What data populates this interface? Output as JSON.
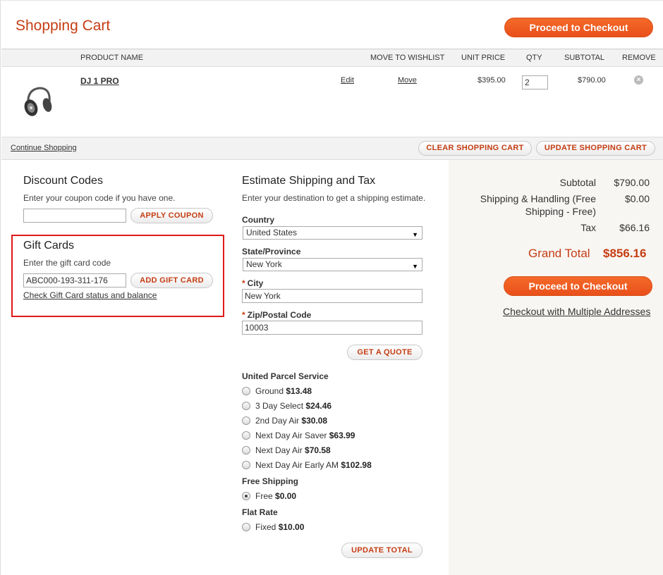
{
  "header": {
    "title": "Shopping Cart",
    "checkout_label": "Proceed to Checkout"
  },
  "table": {
    "columns": [
      "PRODUCT NAME",
      "MOVE TO WISHLIST",
      "UNIT PRICE",
      "QTY",
      "SUBTOTAL",
      "REMOVE"
    ],
    "item": {
      "name": "DJ 1 PRO",
      "edit": "Edit",
      "move": "Move",
      "unit_price": "$395.00",
      "qty": "2",
      "subtotal": "$790.00"
    }
  },
  "actions": {
    "continue": "Continue Shopping",
    "clear": "CLEAR SHOPPING CART",
    "update": "UPDATE SHOPPING CART"
  },
  "discount": {
    "title": "Discount Codes",
    "hint": "Enter your coupon code if you have one.",
    "value": "",
    "button": "APPLY COUPON"
  },
  "gift": {
    "title": "Gift Cards",
    "hint": "Enter the gift card code",
    "value": "ABC000-193-311-176",
    "button": "ADD GIFT CARD",
    "check_link": "Check Gift Card status and balance"
  },
  "shipping": {
    "title": "Estimate Shipping and Tax",
    "hint": "Enter your destination to get a shipping estimate.",
    "country_label": "Country",
    "country": "United States",
    "state_label": "State/Province",
    "state": "New York",
    "city_label": "City",
    "city": "New York",
    "zip_label": "Zip/Postal Code",
    "zip": "10003",
    "quote_button": "GET A QUOTE",
    "ups_label": "United Parcel Service",
    "ups": [
      {
        "name": "Ground",
        "price": "$13.48"
      },
      {
        "name": "3 Day Select",
        "price": "$24.46"
      },
      {
        "name": "2nd Day Air",
        "price": "$30.08"
      },
      {
        "name": "Next Day Air Saver",
        "price": "$63.99"
      },
      {
        "name": "Next Day Air",
        "price": "$70.58"
      },
      {
        "name": "Next Day Air Early AM",
        "price": "$102.98"
      }
    ],
    "free_label": "Free Shipping",
    "free": {
      "name": "Free",
      "price": "$0.00"
    },
    "flat_label": "Flat Rate",
    "flat": {
      "name": "Fixed",
      "price": "$10.00"
    },
    "update_button": "UPDATE TOTAL"
  },
  "summary": {
    "subtotal_label": "Subtotal",
    "subtotal": "$790.00",
    "shipping_label_1": "Shipping & Handling (Free",
    "shipping_label_2": "Shipping - Free)",
    "shipping": "$0.00",
    "tax_label": "Tax",
    "tax": "$66.16",
    "grand_label": "Grand Total",
    "grand": "$856.16",
    "checkout_label": "Proceed to Checkout",
    "multi": "Checkout with Multiple Addresses"
  },
  "colors": {
    "accent": "#c53d13",
    "button": "#ee5b20",
    "highlight": "#e01818"
  }
}
